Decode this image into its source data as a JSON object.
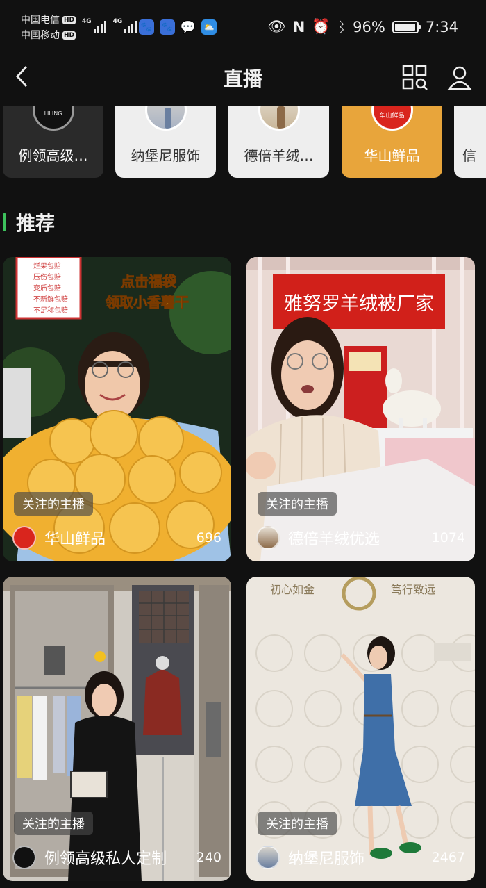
{
  "status_bar": {
    "carrier_1": "中国电信",
    "carrier_2": "中国移动",
    "hd_label": "HD",
    "network_1": "4G",
    "network_2": "4G",
    "battery_percent": "96%",
    "battery_level": 0.96,
    "time": "7:34"
  },
  "nav": {
    "title": "直播",
    "back_icon": "chevron-left-icon",
    "scan_icon": "grid-search-icon",
    "user_icon": "person-icon"
  },
  "anchors": [
    {
      "name": "例领高级…",
      "bg": "#2a2a2a",
      "fg": "#ffffff"
    },
    {
      "name": "纳堡尼服饰",
      "bg": "#eeeeee",
      "fg": "#333333"
    },
    {
      "name": "德倍羊绒…",
      "bg": "#eeeeee",
      "fg": "#333333"
    },
    {
      "name": "华山鲜品",
      "bg": "#e8a53b",
      "fg": "#ffffff"
    },
    {
      "name": "信",
      "bg": "#eeeeee",
      "fg": "#333333"
    }
  ],
  "section": {
    "title": "推荐",
    "accent": "#3dc15c"
  },
  "live_cards": [
    {
      "tag": "关注的主播",
      "name": "华山鲜品",
      "count": "696",
      "promo_1": "点击福袋",
      "promo_2": "领取小香薯干",
      "sign_lines": [
        "烂果包赔",
        "压伤包赔",
        "变质包赔",
        "不新鲜包赔",
        "不足称包赔"
      ]
    },
    {
      "tag": "关注的主播",
      "name": "德倍羊绒优选",
      "count": "1074",
      "banner": "雅努罗羊绒被厂家"
    },
    {
      "tag": "关注的主播",
      "name": "例领高级私人定制",
      "count": "240"
    },
    {
      "tag": "关注的主播",
      "name": "纳堡尼服饰",
      "count": "2467",
      "wall_text_left": "初心如金",
      "wall_text_right": "笃行致远"
    }
  ]
}
